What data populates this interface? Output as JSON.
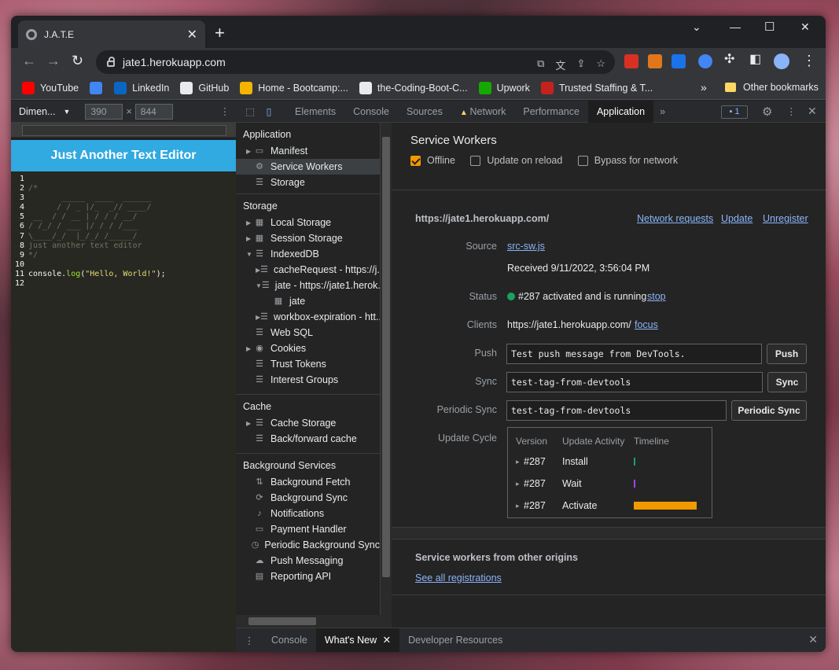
{
  "browser": {
    "tab_title": "J.A.T.E",
    "url": "jate1.herokuapp.com",
    "bookmarks": [
      {
        "label": "YouTube",
        "color": "#ff0000"
      },
      {
        "label": "",
        "color": "#4285f4"
      },
      {
        "label": "LinkedIn",
        "color": "#0a66c2"
      },
      {
        "label": "GitHub",
        "color": "#e8eaed"
      },
      {
        "label": "Home - Bootcamp:...",
        "color": "#f4b400"
      },
      {
        "label": "the-Coding-Boot-C...",
        "color": "#e8eaed"
      },
      {
        "label": "Upwork",
        "color": "#14a800"
      },
      {
        "label": "Trusted Staffing & T...",
        "color": "#c5221f"
      }
    ],
    "other_bookmarks": "Other bookmarks",
    "more": "»"
  },
  "device": {
    "label": "Dimen...",
    "width": "390",
    "height": "844",
    "times": "×"
  },
  "app": {
    "header": "Just Another Text Editor",
    "lines": [
      {
        "n": "1",
        "text": "",
        "kind": "t"
      },
      {
        "n": "2",
        "text": "/*",
        "kind": "t"
      },
      {
        "n": "3",
        "text": "       _____  ____  ______",
        "kind": "t"
      },
      {
        "n": "4",
        "text": "      / / _ |/_  _// ____/",
        "kind": "t"
      },
      {
        "n": "5",
        "text": " __  / / __ | / / / __/",
        "kind": "t"
      },
      {
        "n": "6",
        "text": "/ /_/ / ___ |/ / / /___",
        "kind": "t"
      },
      {
        "n": "7",
        "text": "\\____/_/  |_/_/ /_____/",
        "kind": "t"
      },
      {
        "n": "8",
        "text": "just another text editor",
        "kind": "t"
      },
      {
        "n": "9",
        "text": "*/",
        "kind": "t"
      },
      {
        "n": "10",
        "text": "",
        "kind": "t"
      },
      {
        "n": "11",
        "text": "console.log(\"Hello, World!\");",
        "kind": "c"
      },
      {
        "n": "12",
        "text": "",
        "kind": "t"
      }
    ]
  },
  "devtools": {
    "tabs": [
      "Elements",
      "Console",
      "Sources",
      "Network",
      "Performance",
      "Application"
    ],
    "active_tab": "Application",
    "more": "»",
    "issues": "1",
    "sidebar": {
      "application_title": "Application",
      "application_items": [
        {
          "label": "Manifest",
          "icon": "file-icon",
          "arrow": "▶"
        },
        {
          "label": "Service Workers",
          "icon": "gear-icon",
          "arrow": ""
        },
        {
          "label": "Storage",
          "icon": "database-icon",
          "arrow": ""
        }
      ],
      "storage_title": "Storage",
      "storage_items": [
        {
          "label": "Local Storage",
          "indent": 0,
          "arrow": "▶",
          "icon": "grid"
        },
        {
          "label": "Session Storage",
          "indent": 0,
          "arrow": "▶",
          "icon": "grid"
        },
        {
          "label": "IndexedDB",
          "indent": 0,
          "arrow": "▼",
          "icon": "db"
        },
        {
          "label": "cacheRequest - https://j...",
          "indent": 1,
          "arrow": "▶",
          "icon": "db"
        },
        {
          "label": "jate - https://jate1.herok...",
          "indent": 1,
          "arrow": "▼",
          "icon": "db"
        },
        {
          "label": "jate",
          "indent": 2,
          "arrow": "",
          "icon": "grid"
        },
        {
          "label": "workbox-expiration - htt...",
          "indent": 1,
          "arrow": "▶",
          "icon": "db"
        },
        {
          "label": "Web SQL",
          "indent": 0,
          "arrow": "",
          "icon": "db"
        },
        {
          "label": "Cookies",
          "indent": 0,
          "arrow": "▶",
          "icon": "cookie"
        },
        {
          "label": "Trust Tokens",
          "indent": 0,
          "arrow": "",
          "icon": "db"
        },
        {
          "label": "Interest Groups",
          "indent": 0,
          "arrow": "",
          "icon": "db"
        }
      ],
      "cache_title": "Cache",
      "cache_items": [
        {
          "label": "Cache Storage",
          "arrow": "▶"
        },
        {
          "label": "Back/forward cache",
          "arrow": ""
        }
      ],
      "bg_title": "Background Services",
      "bg_items": [
        {
          "label": "Background Fetch",
          "icon": "⇅"
        },
        {
          "label": "Background Sync",
          "icon": "⟳"
        },
        {
          "label": "Notifications",
          "icon": "♪"
        },
        {
          "label": "Payment Handler",
          "icon": "▭"
        },
        {
          "label": "Periodic Background Sync",
          "icon": "◷"
        },
        {
          "label": "Push Messaging",
          "icon": "☁"
        },
        {
          "label": "Reporting API",
          "icon": "▤"
        }
      ]
    },
    "sw": {
      "title": "Service Workers",
      "offline": "Offline",
      "update_on_reload": "Update on reload",
      "bypass": "Bypass for network",
      "origin": "https://jate1.herokuapp.com/",
      "network_requests": "Network requests",
      "update": "Update",
      "unregister": "Unregister",
      "source_label": "Source",
      "source": "src-sw.js",
      "received": "Received 9/11/2022, 3:56:04 PM",
      "status_label": "Status",
      "status": "#287 activated and is running",
      "stop": "stop",
      "clients_label": "Clients",
      "clients": "https://jate1.herokuapp.com/",
      "focus": "focus",
      "push_label": "Push",
      "push_value": "Test push message from DevTools.",
      "push_btn": "Push",
      "sync_label": "Sync",
      "sync_value": "test-tag-from-devtools",
      "sync_btn": "Sync",
      "periodic_label": "Periodic Sync",
      "periodic_value": "test-tag-from-devtools",
      "periodic_btn": "Periodic Sync",
      "cycle_label": "Update Cycle",
      "cycle_headers": [
        "Version",
        "Update Activity",
        "Timeline"
      ],
      "cycle_rows": [
        {
          "version": "#287",
          "activity": "Install",
          "color": "#1aa260",
          "fill": 0.02
        },
        {
          "version": "#287",
          "activity": "Wait",
          "color": "#a142f4",
          "fill": 0.02
        },
        {
          "version": "#287",
          "activity": "Activate",
          "color": "#f29900",
          "fill": 1.0
        }
      ],
      "other_title": "Service workers from other origins",
      "see_all": "See all registrations"
    },
    "drawer_tabs": [
      "Console",
      "What's New",
      "Developer Resources"
    ],
    "drawer_active": "What's New"
  }
}
